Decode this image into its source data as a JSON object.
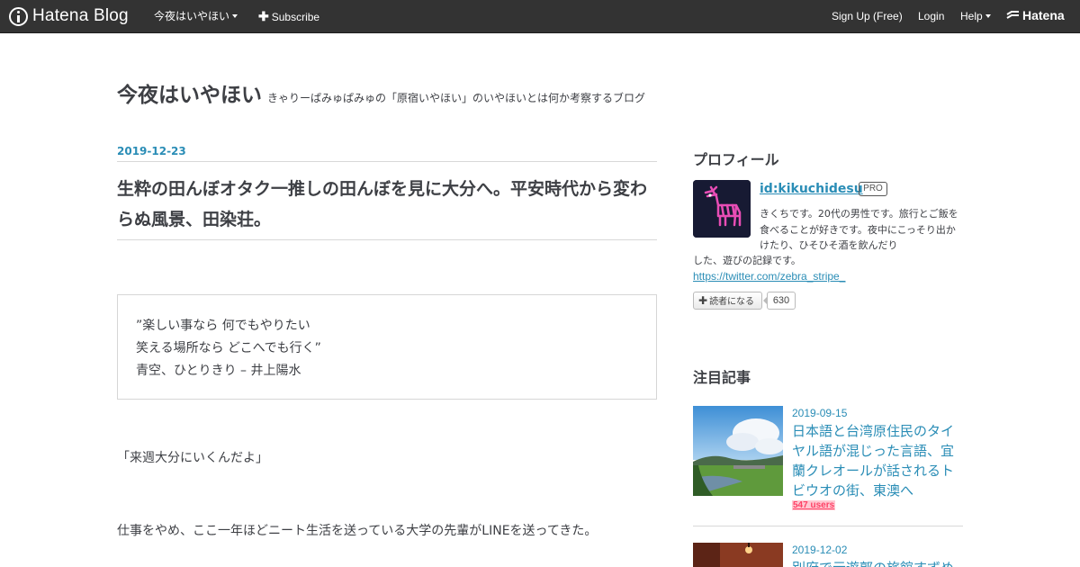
{
  "header": {
    "logo_text": "Hatena Blog",
    "blog_menu": "今夜はいやほい",
    "subscribe": "Subscribe",
    "signup": "Sign Up (Free)",
    "login": "Login",
    "help": "Help",
    "hatena": "Hatena",
    "colors": {
      "bar": "#333333",
      "text": "#ffffff"
    }
  },
  "blog": {
    "title": "今夜はいやほい",
    "description": "きゃりーぱみゅぱみゅの「原宿いやほい」のいやほいとは何か考察するブログ"
  },
  "entry": {
    "date": "2019-12-23",
    "title": "生粋の田んぼオタク一推しの田んぼを見に大分へ。平安時代から変わらぬ風景、田染荘。",
    "quote": [
      "”楽しい事なら 何でもやりたい",
      "笑える場所なら どこへでも行く”",
      "青空、ひとりきり – 井上陽水"
    ],
    "paragraphs": [
      "「来週大分にいくんだよ」",
      "仕事をやめ、ここ一年ほどニート生活を送っている大学の先輩がLINEを送ってきた。"
    ]
  },
  "sidebar": {
    "profile_heading": "プロフィール",
    "profile_id": "id:kikuchidesu",
    "pro_badge": "PRO",
    "profile_desc": "きくちです。20代の男性です。旅行とご飯を食べることが好きです。夜中にこっそり出かけたり、ひそひそ酒を飲んだり",
    "profile_desc_tail": "した、遊びの記録です。",
    "twitter": "https://twitter.com/zebra_stripe_",
    "subscribe_button": "読者になる",
    "subscriber_count": "630",
    "featured_heading": "注目記事",
    "featured": [
      {
        "date": "2019-09-15",
        "title": "日本語と台湾原住民のタイヤル語が混じった言語、宜蘭クレオールが話されるトビウオの街、東澳へ",
        "users": "547 users"
      },
      {
        "date": "2019-12-02",
        "title": "別府で元遊郭の旅館すずめ"
      }
    ]
  },
  "colors": {
    "accent": "#2a8db6",
    "text": "#3d3f44",
    "users_red": "#ff4166"
  }
}
